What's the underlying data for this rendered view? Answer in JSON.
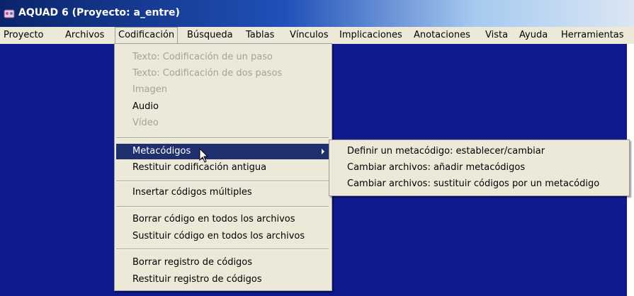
{
  "window": {
    "title": "AQUAD 6 (Proyecto: a_entre)",
    "icon": "app-icon"
  },
  "menubar": {
    "items": [
      "Proyecto",
      "Archivos",
      "Codificación",
      "Búsqueda",
      "Tablas",
      "Vínculos",
      "Implicaciones",
      "Anotaciones",
      "Vista",
      "Ayuda",
      "Herramientas"
    ],
    "active": "Codificación"
  },
  "dropdown": {
    "items": [
      {
        "label": "Texto: Codificación de un paso",
        "state": "disabled"
      },
      {
        "label": "Texto: Codificación de dos pasos",
        "state": "disabled"
      },
      {
        "label": "Imagen",
        "state": "disabled"
      },
      {
        "label": "Audio",
        "state": "enabled"
      },
      {
        "label": "Vídeo",
        "state": "disabled"
      },
      {
        "label": "Metacódigos",
        "state": "highlighted",
        "has_submenu": true
      },
      {
        "label": "Restituir codificación antigua",
        "state": "enabled"
      },
      {
        "label": "Insertar códigos múltiples",
        "state": "enabled"
      },
      {
        "label": "Borrar código en todos los archivos",
        "state": "enabled"
      },
      {
        "label": "Sustituir código en todos los archivos",
        "state": "enabled"
      },
      {
        "label": "Borrar registro de códigos",
        "state": "enabled"
      },
      {
        "label": "Restituir registro de códigos",
        "state": "enabled"
      }
    ]
  },
  "submenu": {
    "items": [
      "Definir un metacódigo: establecer/cambiar",
      "Cambiar archivos: añadir metacódigos",
      "Cambiar archivos: sustituir códigos por un metacódigo"
    ]
  },
  "colors": {
    "workspace": "#0f1a8c",
    "menu_bg": "#ece9d8",
    "highlight": "#20306e",
    "disabled_text": "#a7a390"
  }
}
